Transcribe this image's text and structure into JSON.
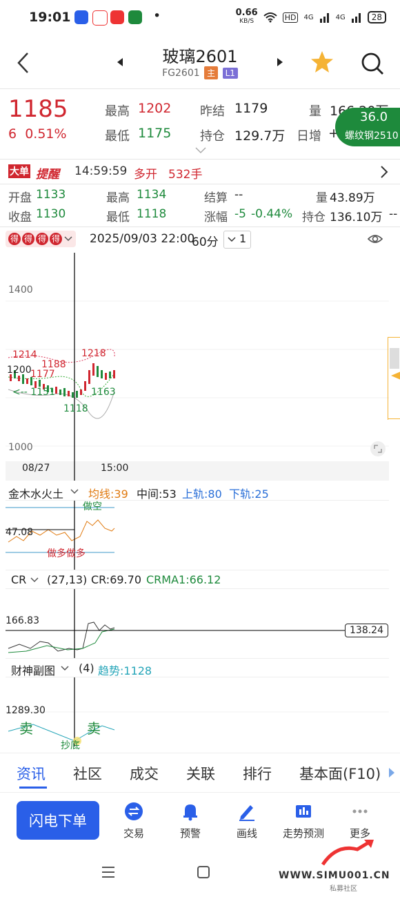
{
  "status": {
    "time": "19:01",
    "speed": "0.66",
    "speed_unit": "KB/S",
    "hd": "HD",
    "signal1": "4G",
    "signal2": "4G",
    "battery": "28",
    "dot": "•"
  },
  "header": {
    "title": "玻璃2601",
    "code": "FG2601",
    "tag_main": "主",
    "tag_level": "L1",
    "back_icon": "back-icon",
    "star_icon": "star-icon",
    "search_icon": "search-icon"
  },
  "quote": {
    "price": "1185",
    "change": "6",
    "change_pct": "0.51%",
    "high_label": "最高",
    "high": "1202",
    "low_label": "最低",
    "low": "1175",
    "prev_settle_label": "昨结",
    "prev_settle": "1179",
    "open_int_label": "持仓",
    "open_int": "129.7万",
    "vol_label": "量",
    "vol": "166.20万",
    "daily_inc_label": "日增",
    "daily_inc": "+1",
    "float_name": "螺纹钢2510",
    "float_value": "36.0"
  },
  "alert": {
    "badge1": "大单",
    "badge2": "提醒",
    "time": "14:59:59",
    "action": "多开",
    "qty": "532手"
  },
  "bar_info": {
    "open_label": "开盘",
    "open": "1133",
    "high_label": "最高",
    "high": "1134",
    "settle_label": "结算",
    "settle": "--",
    "vol_label": "量",
    "vol": "43.89万",
    "close_label": "收盘",
    "close": "1130",
    "low_label": "最低",
    "low": "1118",
    "chg_label": "涨幅",
    "chg": "-5",
    "chg_pct": "-0.44%",
    "oi_label": "持仓",
    "oi": "136.10万",
    "trail": "--"
  },
  "chart_toolbar": {
    "badge_chars": [
      "得",
      "得",
      "得",
      "得"
    ],
    "datetime": "2025/09/03 22:00",
    "period": "60分",
    "ratio": "1"
  },
  "main_chart": {
    "y_top": "1400",
    "y_bottom": "1000",
    "date_left": "08/27",
    "date_right": "15:00",
    "labels": {
      "l1214": "1214",
      "l1188": "1188",
      "l1218": "1218",
      "l1200": "1200",
      "l1177": "1177",
      "l1151": "<-- 1151",
      "l1163": "1163",
      "l1118": "1118"
    }
  },
  "indicator1": {
    "name": "金木水火土",
    "avg_label": "均线:39",
    "mid_label": "中间:53",
    "upper_label": "上轨:80",
    "lower_label": "下轨:25",
    "value": "47.08",
    "text_short": "做空",
    "text_long1": "做多",
    "text_long2": "做多"
  },
  "indicator2": {
    "name": "CR",
    "params": "(27,13)",
    "cr": "CR:69.70",
    "crma": "CRMA1:66.12",
    "value": "166.83",
    "cursor": "138.24"
  },
  "indicator3": {
    "name": "财神副图",
    "param": "(4)",
    "trend": "趋势:1128",
    "value": "1289.30",
    "sell1": "卖",
    "sell2": "卖",
    "buy_low": "抄底"
  },
  "bottom_tabs": [
    "资讯",
    "社区",
    "成交",
    "关联",
    "排行",
    "基本面(F10)"
  ],
  "toolbar": {
    "flash_order": "闪电下单",
    "items": [
      "交易",
      "预警",
      "画线",
      "走势预测",
      "更多"
    ]
  },
  "watermark": {
    "site": "WWW.SIMU001.CN",
    "sub": "私募社区"
  },
  "colors": {
    "up": "#d0262f",
    "down": "#1e8a3c",
    "accent": "#2a5fe8",
    "orange": "#e07a10"
  }
}
